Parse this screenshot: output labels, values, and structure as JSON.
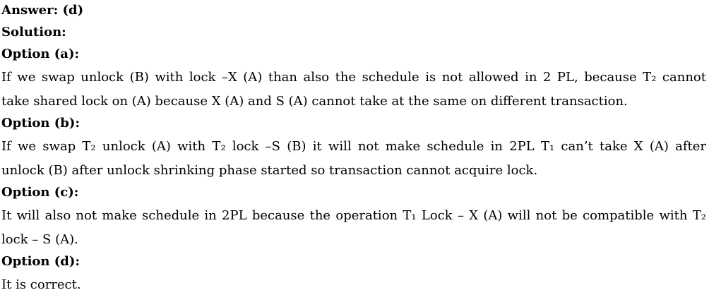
{
  "answer_label": "Answer: (d)",
  "solution_label": "Solution:",
  "options": [
    {
      "heading": "Option (a):",
      "lines": [
        "If we swap unlock (B) with lock –X (A) than also the schedule is not allowed in 2 PL, because T₂ cannot",
        "take shared lock on (A) because X (A) and S (A) cannot take at the same on different transaction."
      ]
    },
    {
      "heading": "Option (b):",
      "lines": [
        "If we swap T₂ unlock (A) with T₂ lock –S (B) it will not make schedule in 2PL T₁ can’t take X (A) after",
        "unlock (B) after unlock shrinking phase started so transaction cannot acquire lock."
      ]
    },
    {
      "heading": "Option (c):",
      "lines": [
        "It will also not make schedule in 2PL because the operation T₁ Lock – X (A) will not be compatible with T₂",
        "lock – S (A)."
      ]
    },
    {
      "heading": "Option (d):",
      "lines": [
        "It is correct."
      ]
    }
  ]
}
